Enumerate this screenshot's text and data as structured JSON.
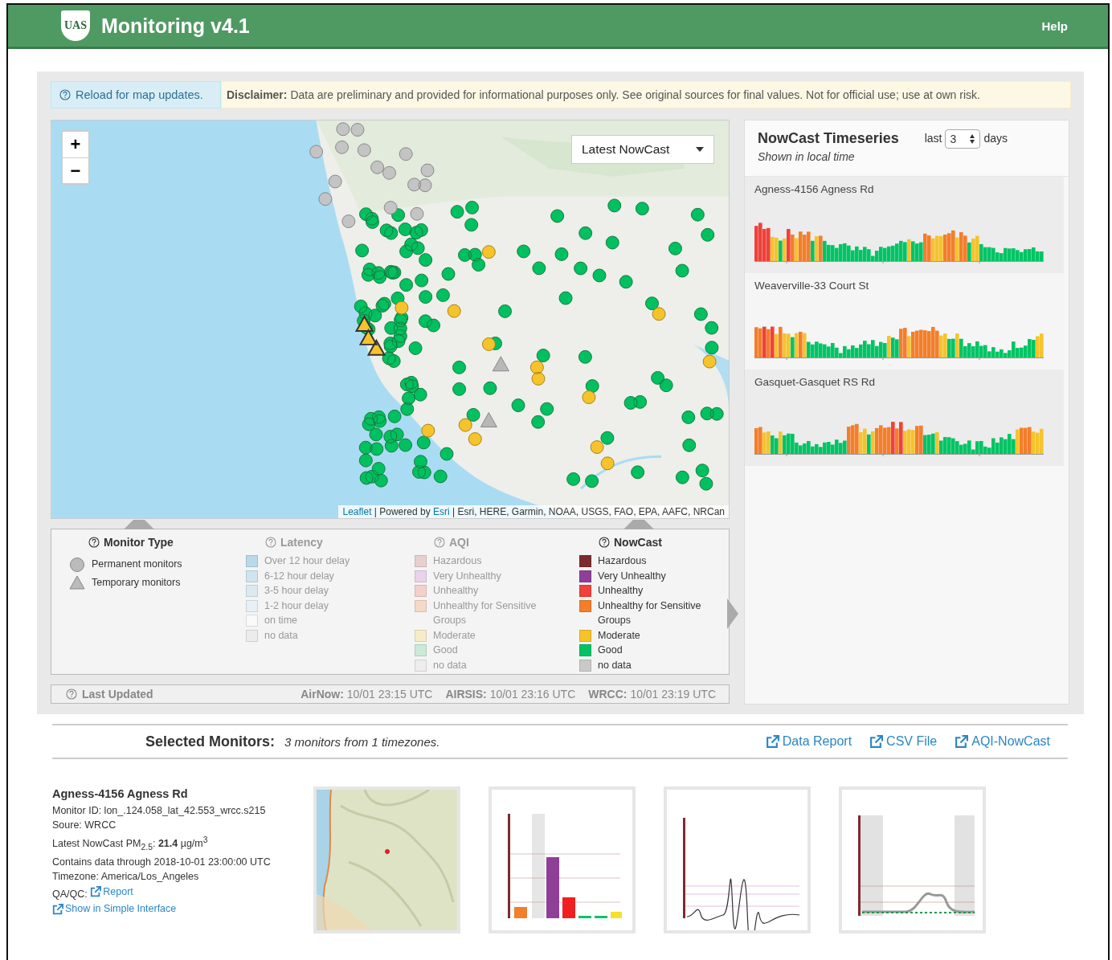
{
  "header": {
    "logo": "UAS",
    "title": "Monitoring v4.1",
    "help": "Help"
  },
  "notice": {
    "reload": "Reload for map updates.",
    "disclaimer_label": "Disclaimer:",
    "disclaimer": "Data are preliminary and provided for informational purposes only. See original sources for final values. Not for official use; use at own risk."
  },
  "map": {
    "zoom_in": "+",
    "zoom_out": "−",
    "layer_select": "Latest NowCast",
    "attribution": {
      "leaflet": "Leaflet",
      "powered": "| Powered by",
      "esri": "Esri",
      "sources": "| Esri, HERE, Garmin, NOAA, USGS, FAO, EPA, AAFC, NRCan"
    }
  },
  "legend": [
    {
      "title": "Monitor Type",
      "disabled": false,
      "kind": "shapes",
      "items": [
        {
          "label": "Permanent monitors",
          "kind": "circle"
        },
        {
          "label": "Temporary monitors",
          "kind": "triangle"
        }
      ]
    },
    {
      "title": "Latency",
      "disabled": true,
      "kind": "swatches",
      "items": [
        {
          "label": "Over 12 hour delay",
          "color": "#b9d9ea"
        },
        {
          "label": "6-12 hour delay",
          "color": "#cfe4ef"
        },
        {
          "label": "3-5 hour delay",
          "color": "#dde9f1"
        },
        {
          "label": "1-2 hour delay",
          "color": "#e9f0f5"
        },
        {
          "label": "on time",
          "color": "#f9f9f9"
        },
        {
          "label": "no data",
          "color": "#ececec"
        }
      ]
    },
    {
      "title": "AQI",
      "disabled": true,
      "kind": "swatches",
      "items": [
        {
          "label": "Hazardous",
          "color": "#e8cfd0"
        },
        {
          "label": "Very Unhealthy",
          "color": "#e9d3ea"
        },
        {
          "label": "Unhealthy",
          "color": "#f4d0cd"
        },
        {
          "label": "Unhealthy for Sensitive Groups",
          "color": "#f5d9c8"
        },
        {
          "label": "Moderate",
          "color": "#f7ecc9"
        },
        {
          "label": "Good",
          "color": "#c9ebd8"
        },
        {
          "label": "no data",
          "color": "#ededed"
        }
      ]
    },
    {
      "title": "NowCast",
      "disabled": false,
      "kind": "swatches",
      "items": [
        {
          "label": "Hazardous",
          "color": "#7e2b2f"
        },
        {
          "label": "Very Unhealthy",
          "color": "#8f3f97"
        },
        {
          "label": "Unhealthy",
          "color": "#f0413a"
        },
        {
          "label": "Unhealthy for Sensitive Groups",
          "color": "#f47e2a"
        },
        {
          "label": "Moderate",
          "color": "#f6c32b"
        },
        {
          "label": "Good",
          "color": "#00c464"
        },
        {
          "label": "no data",
          "color": "#c9c9c9"
        }
      ]
    }
  ],
  "last_updated": {
    "label": "Last Updated",
    "sources": [
      {
        "name": "AirNow:",
        "time": "10/01 23:15 UTC"
      },
      {
        "name": "AIRSIS:",
        "time": "10/01 23:16 UTC"
      },
      {
        "name": "WRCC:",
        "time": "10/01 23:19 UTC"
      }
    ]
  },
  "timeseries": {
    "title": "NowCast Timeseries",
    "subtitle": "Shown in local time",
    "prefix": "last",
    "days": "3",
    "suffix": "days",
    "monitors": [
      {
        "name": "Agness-4156 Agness Rd"
      },
      {
        "name": "Weaverville-33 Court St"
      },
      {
        "name": "Gasquet-Gasquet RS Rd"
      }
    ]
  },
  "selected": {
    "label": "Selected Monitors:",
    "summary": "3 monitors from 1 timezones.",
    "links": [
      "Data Report",
      "CSV File",
      "AQI-NowCast"
    ]
  },
  "monitor": {
    "name": "Agness-4156 Agness Rd",
    "lines": [
      "Monitor ID: lon_.124.058_lat_42.553_wrcc.s215",
      "Soure: WRCC",
      "Latest NowCast PM$_{2.5}$: **21.4** µg/m$^{3}$",
      "Contains data through 2018-10-01 23:00:00 UTC",
      "Timezone: America/Los_Angeles"
    ],
    "qaqc_label": "QA/QC:",
    "qaqc_link": "Report",
    "simple_link": "Show in Simple Interface"
  },
  "thumbnails": [
    {
      "kind": "picture"
    },
    {
      "kind": "bar"
    },
    {
      "kind": "line"
    },
    {
      "kind": "daily"
    }
  ]
}
